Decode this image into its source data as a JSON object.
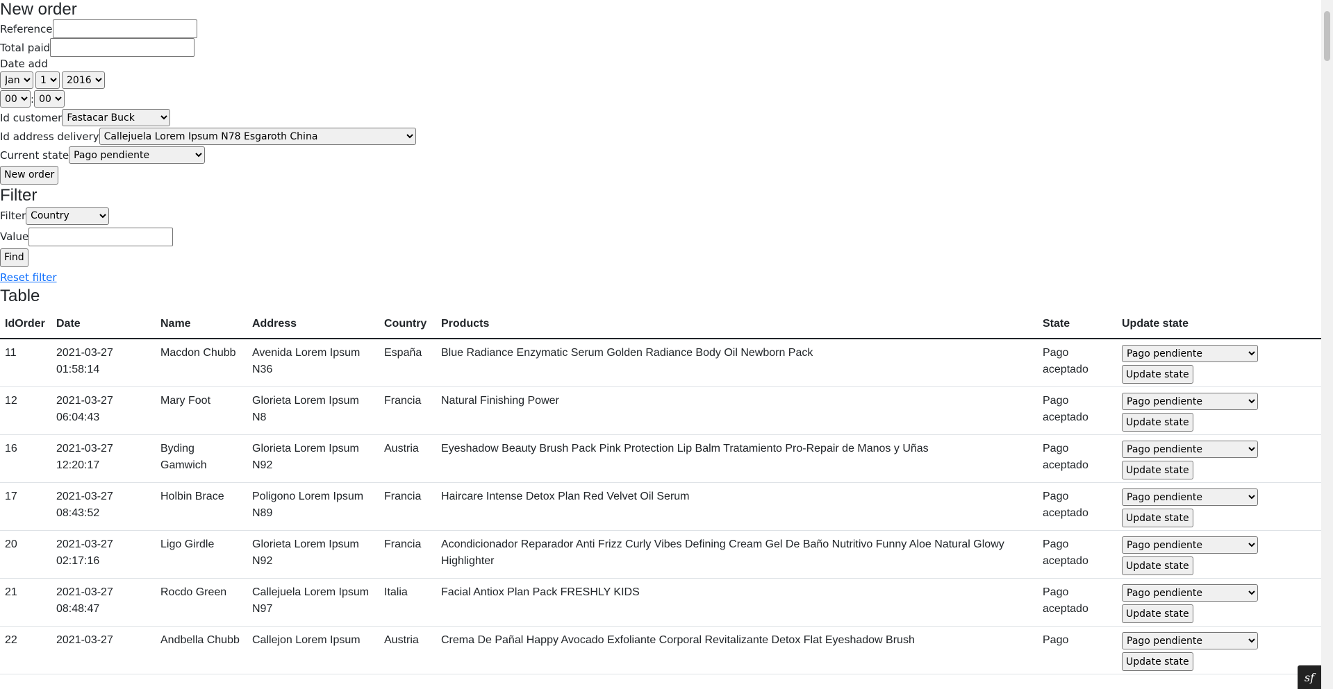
{
  "new_order": {
    "title": "New order",
    "reference_label": "Reference",
    "reference_value": "",
    "total_paid_label": "Total paid",
    "total_paid_value": "",
    "date_add_label": "Date add",
    "month": "Jan",
    "day": "1",
    "year": "2016",
    "hour": "00",
    "time_separator": ":",
    "minute": "00",
    "id_customer_label": "Id customer",
    "id_customer_value": "Fastacar Buck",
    "id_address_label": "Id address delivery",
    "id_address_value": "Callejuela Lorem Ipsum N78 Esgaroth China",
    "current_state_label": "Current state",
    "current_state_value": "Pago pendiente",
    "submit_label": "New order"
  },
  "filter": {
    "title": "Filter",
    "filter_label": "Filter",
    "filter_value": "Country",
    "value_label": "Value",
    "value_value": "",
    "find_label": "Find",
    "reset_label": "Reset filter"
  },
  "table": {
    "title": "Table",
    "columns": [
      "IdOrder",
      "Date",
      "Name",
      "Address",
      "Country",
      "Products",
      "State",
      "Update state"
    ],
    "update_select_value": "Pago pendiente",
    "update_button_label": "Update state",
    "rows": [
      {
        "id": "11",
        "date": "2021-03-27",
        "time": "01:58:14",
        "name": "Macdon Chubb",
        "address": "Avenida Lorem Ipsum N36",
        "country": "España",
        "products": "Blue Radiance Enzymatic Serum Golden Radiance Body Oil Newborn Pack",
        "state": "Pago aceptado"
      },
      {
        "id": "12",
        "date": "2021-03-27",
        "time": "06:04:43",
        "name": "Mary Foot",
        "address": "Glorieta Lorem Ipsum N8",
        "country": "Francia",
        "products": "Natural Finishing Power",
        "state": "Pago aceptado"
      },
      {
        "id": "16",
        "date": "2021-03-27",
        "time": "12:20:17",
        "name": "Byding Gamwich",
        "address": "Glorieta Lorem Ipsum N92",
        "country": "Austria",
        "products": "Eyeshadow Beauty Brush Pack Pink Protection Lip Balm Tratamiento Pro-Repair de Manos y Uñas",
        "state": "Pago aceptado"
      },
      {
        "id": "17",
        "date": "2021-03-27",
        "time": "08:43:52",
        "name": "Holbin Brace",
        "address": "Poligono Lorem Ipsum N89",
        "country": "Francia",
        "products": "Haircare Intense Detox Plan Red Velvet Oil Serum",
        "state": "Pago aceptado"
      },
      {
        "id": "20",
        "date": "2021-03-27",
        "time": "02:17:16",
        "name": "Ligo Girdle",
        "address": "Glorieta Lorem Ipsum N92",
        "country": "Francia",
        "products": "Acondicionador Reparador Anti Frizz Curly Vibes Defining Cream Gel De Baño Nutritivo Funny Aloe Natural Glowy Highlighter",
        "state": "Pago aceptado"
      },
      {
        "id": "21",
        "date": "2021-03-27",
        "time": "08:48:47",
        "name": "Rocdo Green",
        "address": "Callejuela Lorem Ipsum N97",
        "country": "Italia",
        "products": "Facial Antiox Plan Pack FRESHLY KIDS",
        "state": "Pago aceptado"
      },
      {
        "id": "22",
        "date": "2021-03-27",
        "time": "",
        "name": "Andbella Chubb",
        "address": "Callejon Lorem Ipsum",
        "country": "Austria",
        "products": "Crema De Pañal Happy Avocado Exfoliante Corporal Revitalizante Detox Flat Eyeshadow Brush",
        "state": "Pago"
      }
    ]
  },
  "icons": {
    "symfony_badge": "sf"
  }
}
